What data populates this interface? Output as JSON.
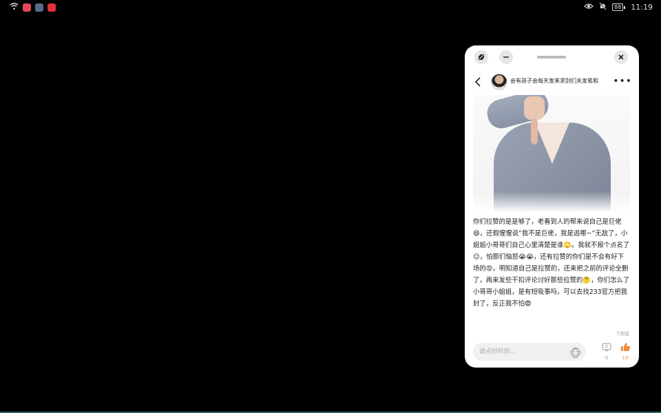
{
  "statusbar": {
    "left_icons": [
      "wifi-icon",
      "notes-app-icon",
      "gallery-app-icon",
      "news-app-icon"
    ],
    "battery": "88",
    "time": "11:19"
  },
  "post": {
    "title": "会有孩子会每天发来求别们关发笔和",
    "body": "你们拉赞的是是够了，老看到人的帮来说自己是巨佬😄，还假惺惺说“我不是巨佬，我是逃哪~”无敌了，小姐姐小哥哥们自己心里清楚是谁🙄。我就不报个点名了😑，怕那们恼怒😭😭，还有拉赞的你们是不会有好下场的😡，明知道自己是拉赞的，还来把之前的评论全删了，再来发些干扣评论讨好那些拉赞的🤔，你们怎么了小哥哥小姐姐，是有短吸事吗，可以去找233官方把我封了，反正我不怕😨",
    "views": "7浏览"
  },
  "footer": {
    "comment_placeholder": "说点好听的…",
    "comment_count": "0",
    "like_count": "10"
  },
  "colors": {
    "accent": "#f08a3a",
    "window_bg": "#ffffff",
    "screen_bg": "#000000"
  }
}
